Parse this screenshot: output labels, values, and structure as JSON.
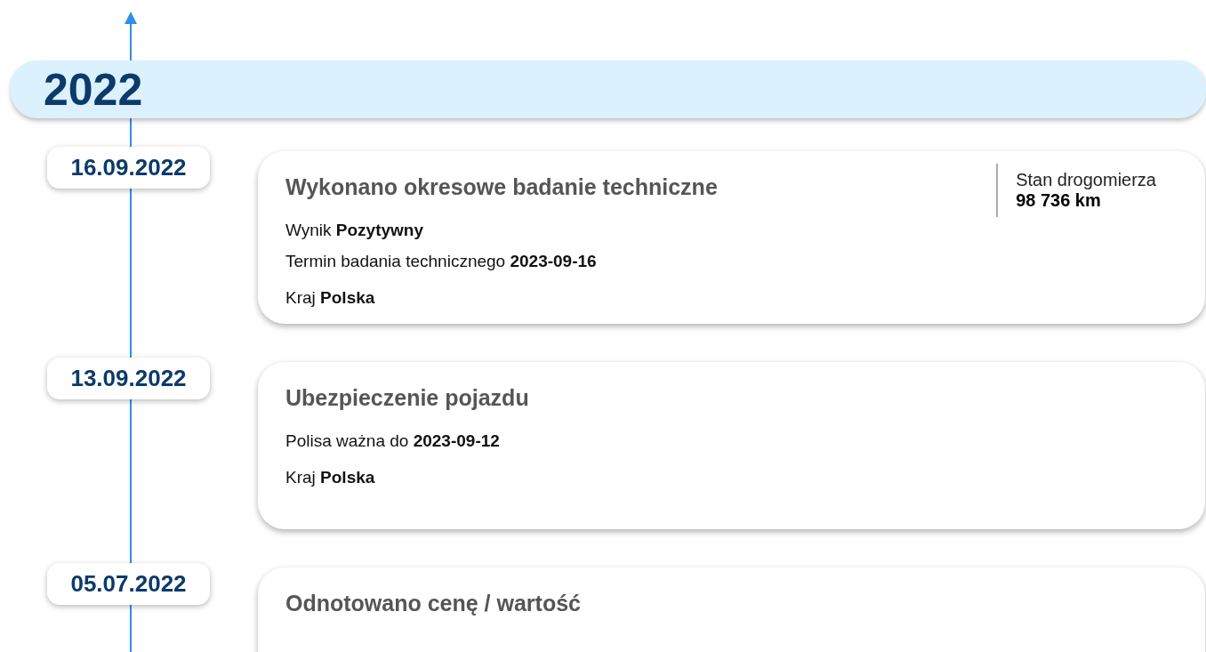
{
  "year": "2022",
  "events": [
    {
      "date": "16.09.2022",
      "title": "Wykonano okresowe badanie techniczne",
      "details": [
        "Wynik **Pozytywny**",
        "Termin badania technicznego **2023-09-16**"
      ],
      "country": "Kraj **Polska**",
      "odometer": {
        "label": "Stan drogomierza",
        "value": "98 736 km"
      }
    },
    {
      "date": "13.09.2022",
      "title": "Ubezpieczenie pojazdu",
      "details": [
        "Polisa ważna do **2023-09-12**"
      ],
      "country": "Kraj **Polska**"
    },
    {
      "date": "05.07.2022",
      "title": "Odnotowano cenę / wartość"
    }
  ]
}
